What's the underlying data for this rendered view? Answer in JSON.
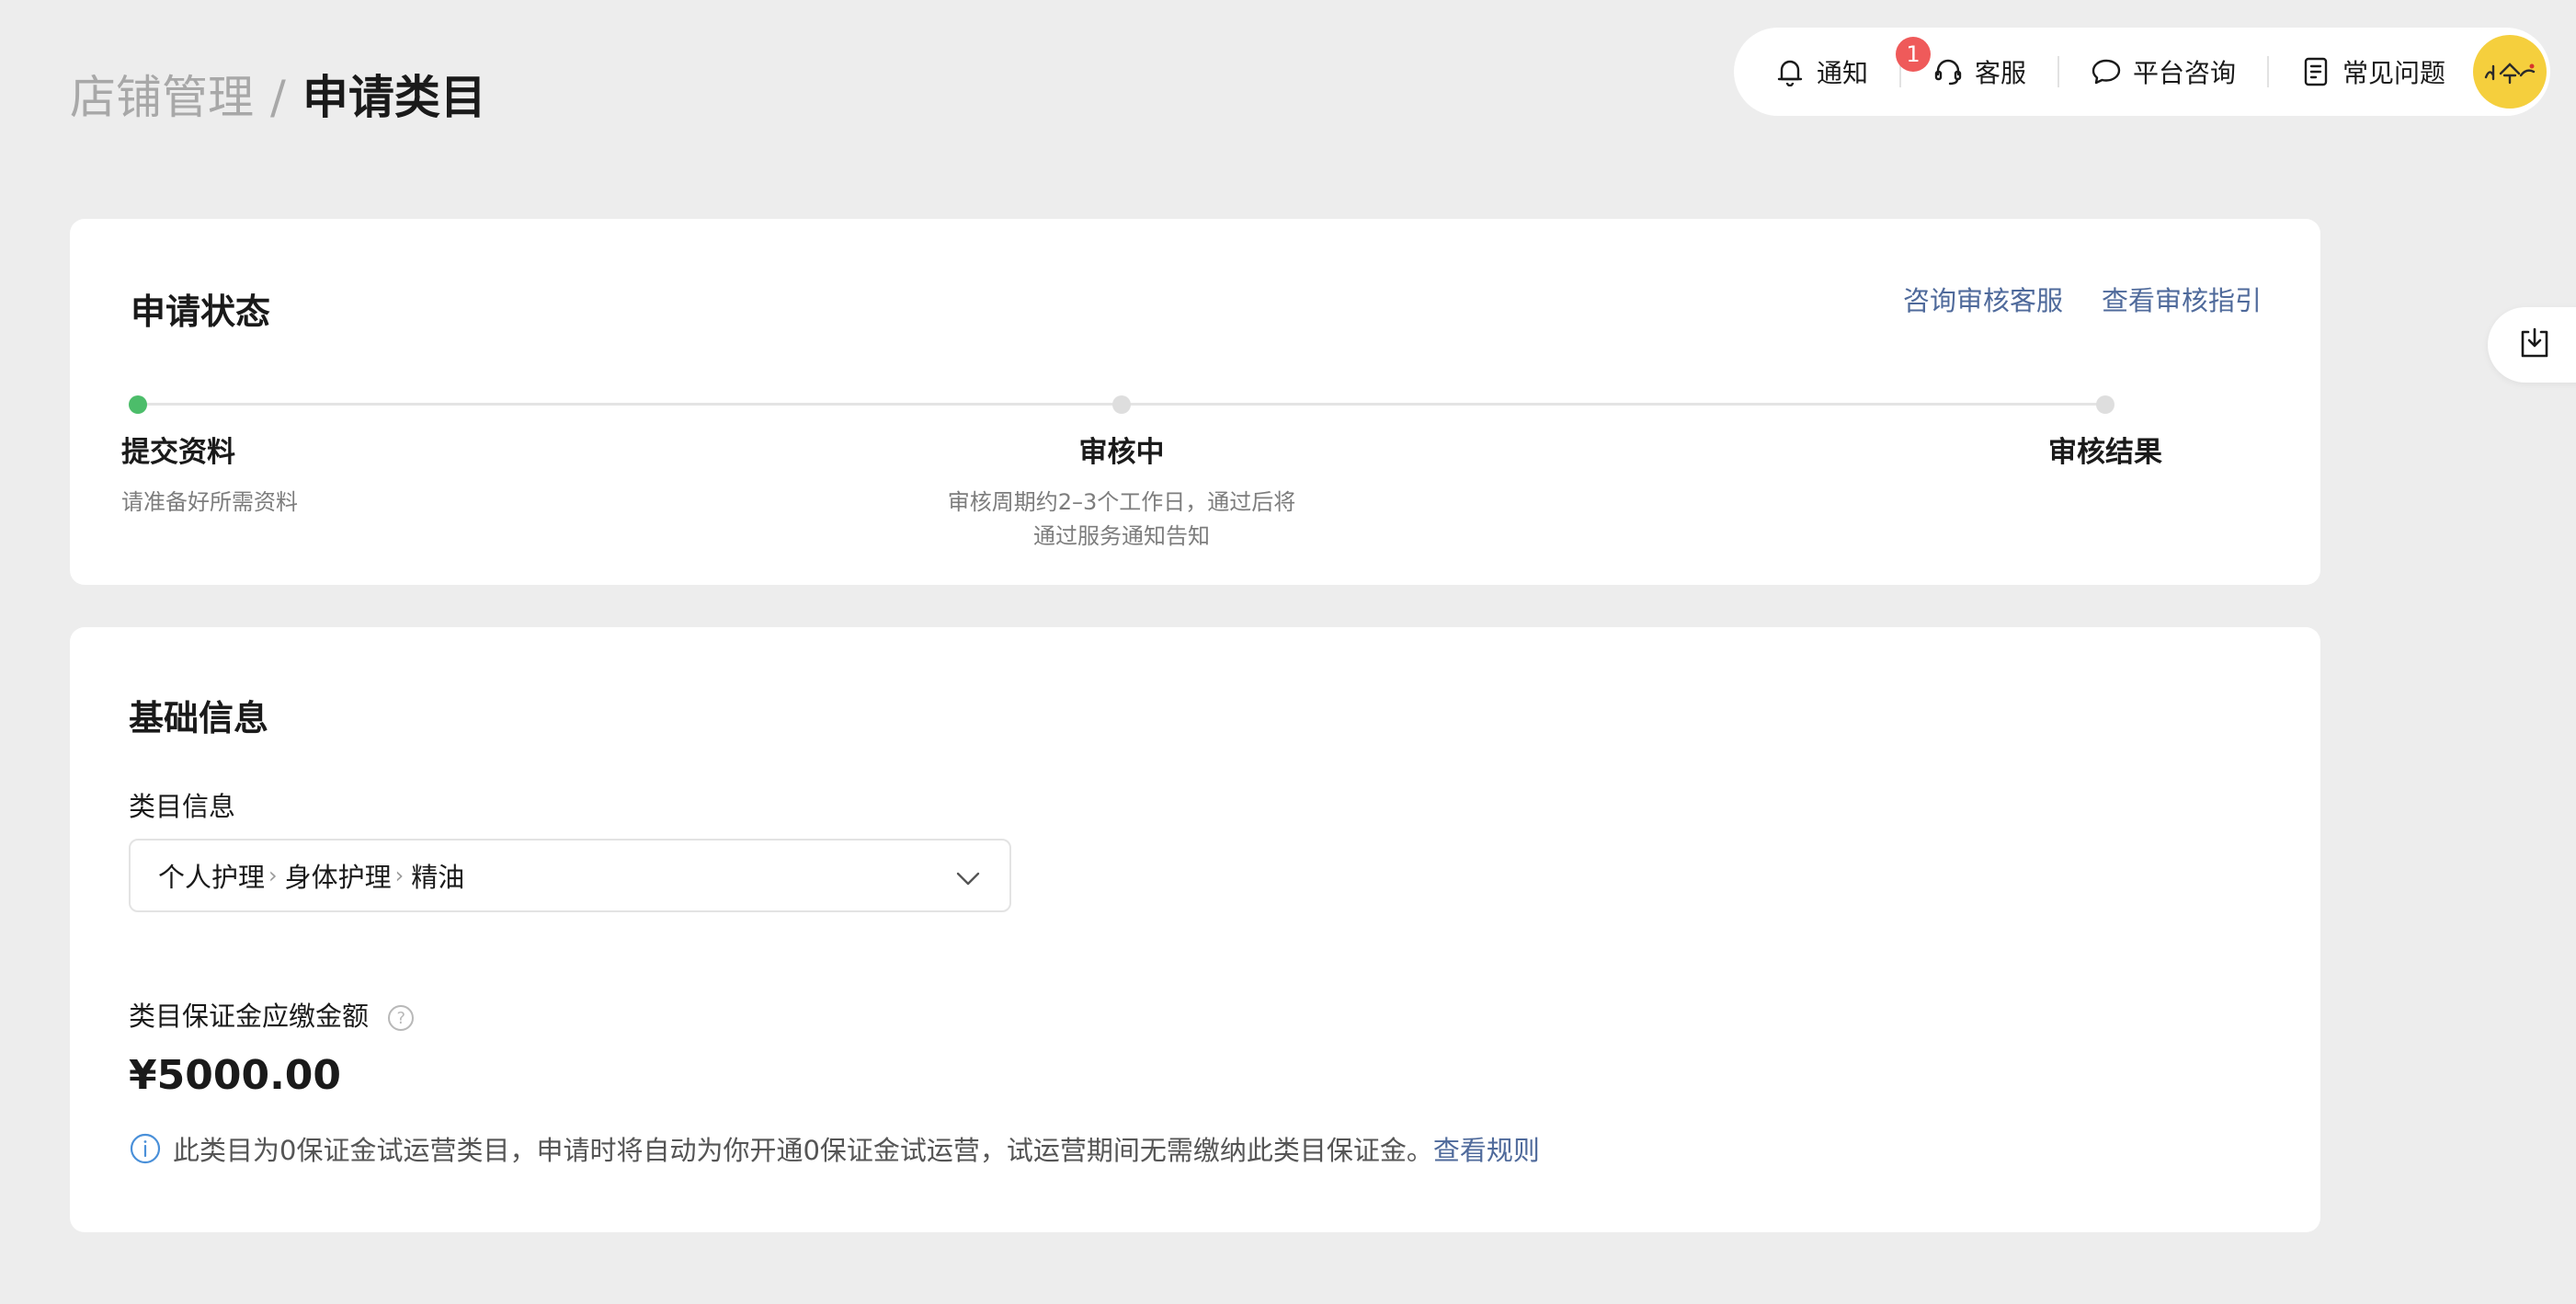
{
  "breadcrumb": {
    "parent": "店铺管理",
    "separator": "/",
    "current": "申请类目"
  },
  "topbar": {
    "notification_label": "通知",
    "notification_count": "1",
    "service_label": "客服",
    "consult_label": "平台咨询",
    "faq_label": "常见问题",
    "avatar_text": "小今",
    "icons": [
      "bell-icon",
      "headset-icon",
      "chat-bubble-icon",
      "document-icon"
    ]
  },
  "status_card": {
    "title": "申请状态",
    "link_consult": "咨询审核客服",
    "link_guide": "查看审核指引",
    "steps": [
      {
        "title": "提交资料",
        "desc": "请准备好所需资料",
        "state": "active"
      },
      {
        "title": "审核中",
        "desc_line1": "审核周期约2–3个工作日，通过后将",
        "desc_line2": "通过服务通知告知",
        "state": "pending"
      },
      {
        "title": "审核结果",
        "state": "pending"
      }
    ]
  },
  "basic_card": {
    "title": "基础信息",
    "category_label": "类目信息",
    "category_path": [
      "个人护理",
      "身体护理",
      "精油"
    ],
    "deposit_label": "类目保证金应缴金额",
    "deposit_amount": "¥5000.00",
    "notice_text": "此类目为0保证金试运营类目，申请时将自动为你开通0保证金试运营，试运营期间无需缴纳此类目保证金。",
    "notice_link": "查看规则"
  },
  "colors": {
    "accent_link": "#4f6a9b",
    "step_active": "#4cbd6a",
    "badge": "#ef5a5a",
    "avatar_bg": "#f5cf3d"
  }
}
